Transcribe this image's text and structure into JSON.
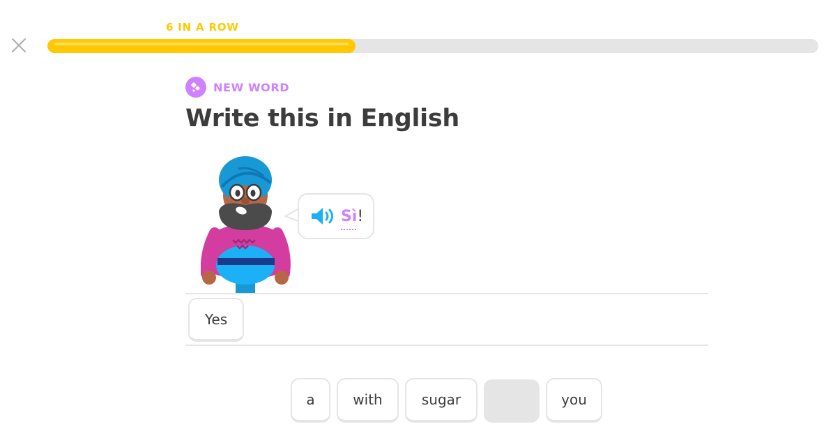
{
  "header": {
    "close_icon": "close-icon",
    "streak_label": "6 IN A ROW",
    "progress": 0.4,
    "progress_color": "#ffc800"
  },
  "challenge": {
    "badge_icon": "new-word-icon",
    "badge_label": "NEW WORD",
    "badge_color": "#ce82ff",
    "title": "Write this in English"
  },
  "speech": {
    "audio_icon": "speaker-icon",
    "word": "Sì",
    "punctuation": "!"
  },
  "answer": {
    "selected_tiles": [
      "Yes"
    ]
  },
  "word_bank": {
    "tiles": [
      "a",
      "with",
      "sugar",
      "",
      "you"
    ]
  }
}
